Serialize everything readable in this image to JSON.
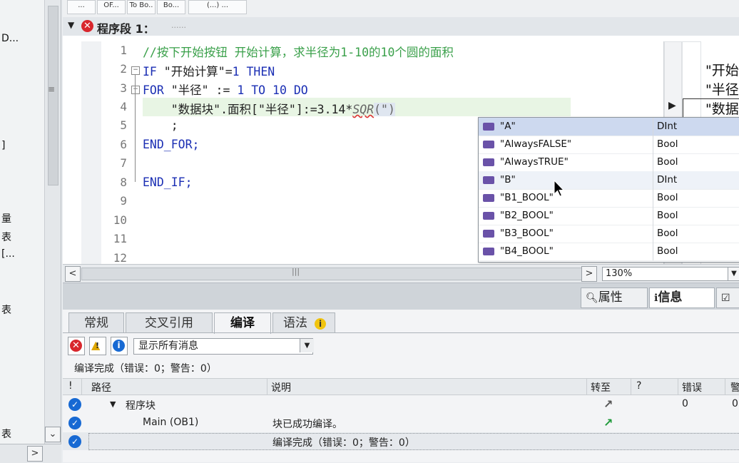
{
  "left_panel": {
    "fragments": [
      "D...",
      "]",
      "量",
      "表",
      "[...",
      "表",
      "表"
    ]
  },
  "toolbar": {
    "buttons": [
      "...",
      "OF...",
      "To Bo..",
      "Bo...",
      "(...) ...",
      "....."
    ]
  },
  "network": {
    "title": "程序段 1：",
    "comment": "......"
  },
  "editor": {
    "line_numbers": [
      "1",
      "2",
      "3",
      "4",
      "5",
      "6",
      "7",
      "8",
      "9",
      "10",
      "11",
      "12"
    ],
    "lines": {
      "l1": "//按下开始按钮 开始计算，求半径为1-10的10个圆的面积",
      "l2_kw1": "IF",
      "l2_str": " \"开始计算\"",
      "l2_op": "=",
      "l2_num": "1",
      "l2_kw2": " THEN",
      "l3_kw1": "FOR",
      "l3_str": " \"半径\" := ",
      "l3_num1": "1",
      "l3_kw2": " TO ",
      "l3_num2": "10",
      "l3_kw3": " DO",
      "l4": "    \"数据块\".面积[\"半径\"]:=3.14*",
      "l4_fn": "SQR",
      "l4_tail": "(\")",
      "l5": "    ;",
      "l6": "END_FOR;",
      "l8": "END_IF;"
    },
    "right_preview": [
      "\"开始",
      "\"半径",
      "\"数据"
    ]
  },
  "autocomplete": {
    "items": [
      {
        "name": "\"A\"",
        "type": "DInt"
      },
      {
        "name": "\"AlwaysFALSE\"",
        "type": "Bool"
      },
      {
        "name": "\"AlwaysTRUE\"",
        "type": "Bool"
      },
      {
        "name": "\"B\"",
        "type": "DInt"
      },
      {
        "name": "\"B1_BOOL\"",
        "type": "Bool"
      },
      {
        "name": "\"B2_BOOL\"",
        "type": "Bool"
      },
      {
        "name": "\"B3_BOOL\"",
        "type": "Bool"
      },
      {
        "name": "\"B4_BOOL\"",
        "type": "Bool"
      }
    ]
  },
  "zoom": {
    "value": "130%"
  },
  "inspector": {
    "tabs": {
      "properties": "属性",
      "info": "信息"
    }
  },
  "bottom_tabs": [
    "常规",
    "交叉引用",
    "编译",
    "语法"
  ],
  "filter": {
    "selected": "显示所有消息"
  },
  "summary": "编译完成（错误：0；警告：0）",
  "messages": {
    "headers": {
      "bang": "!",
      "path": "路径",
      "desc": "说明",
      "goto": "转至",
      "q": "?",
      "errors": "错误",
      "warnings": "警"
    },
    "rows": [
      {
        "path": "程序块",
        "desc": "",
        "errors": "0",
        "warnings": "0"
      },
      {
        "path": "Main (OB1)",
        "desc": "块已成功编译。"
      },
      {
        "path": "",
        "desc": "编译完成（错误：0；警告：0）"
      }
    ]
  },
  "colors": {
    "keyword": "#1b2fb4",
    "comment": "#3aa04a",
    "error": "#d8262c",
    "check": "#1769d3"
  }
}
